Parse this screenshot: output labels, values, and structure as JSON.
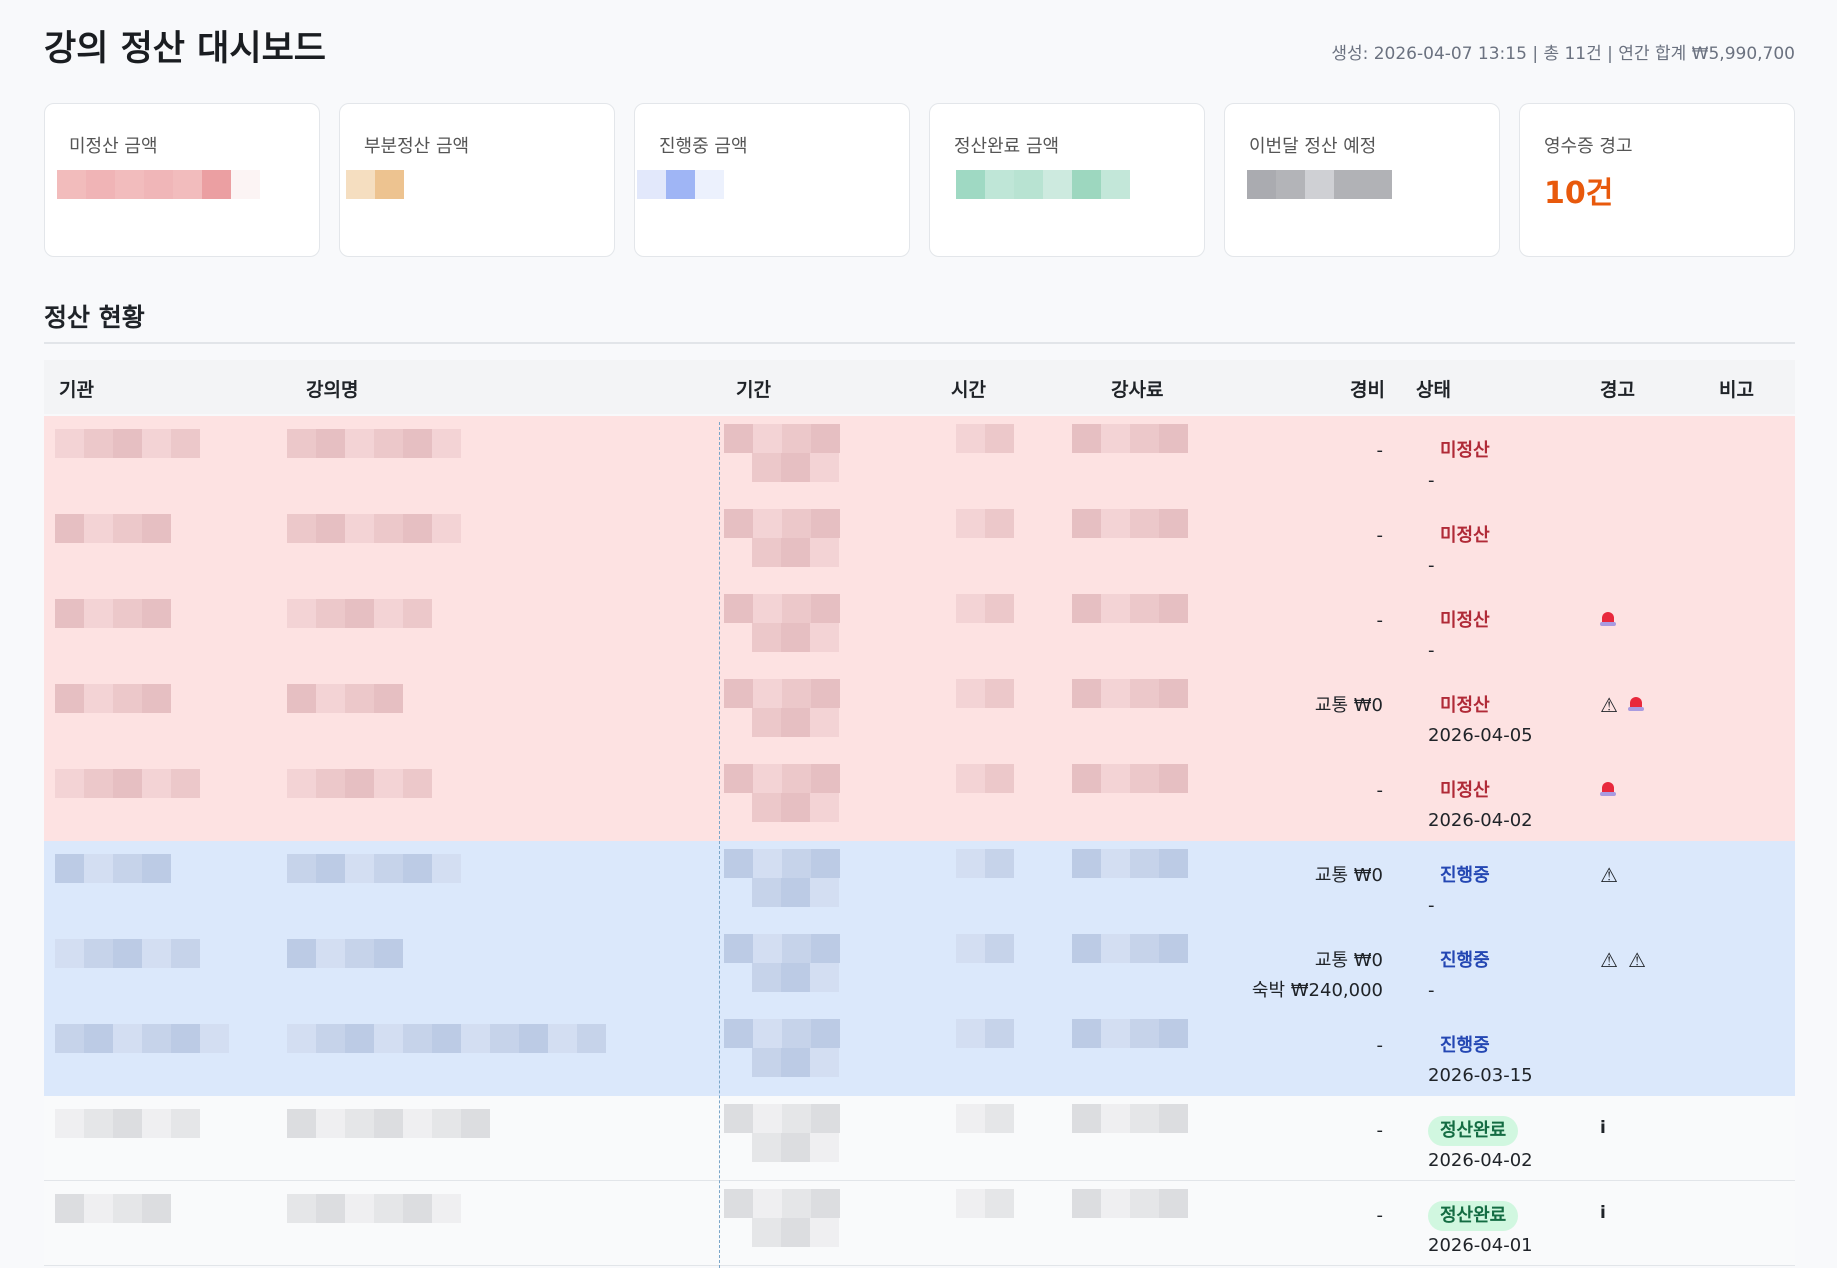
{
  "header": {
    "title": "강의 정산 대시보드",
    "meta": "생성: 2026-04-07 13:15 | 총 11건 | 연간 합계 ₩5,990,700"
  },
  "cards": [
    {
      "label": "미정산 금액"
    },
    {
      "label": "부분정산 금액"
    },
    {
      "label": "진행중 금액"
    },
    {
      "label": "정산완료 금액"
    },
    {
      "label": "이번달 정산 예정"
    },
    {
      "label": "영수증 경고",
      "value": "10건"
    }
  ],
  "section": {
    "title": "정산 현황"
  },
  "table": {
    "headers": [
      "기관",
      "강의명",
      "기간",
      "시간",
      "강사료",
      "경비",
      "상태",
      "경고",
      "비고"
    ],
    "rows": [
      {
        "type": "red",
        "expense": [
          "-"
        ],
        "status": "미정산",
        "date": "-",
        "warnings": []
      },
      {
        "type": "red",
        "expense": [
          "-"
        ],
        "status": "미정산",
        "date": "-",
        "warnings": []
      },
      {
        "type": "red",
        "expense": [
          "-"
        ],
        "status": "미정산",
        "date": "-",
        "warnings": [
          "siren"
        ]
      },
      {
        "type": "red",
        "expense": [
          "교통 ₩0"
        ],
        "status": "미정산",
        "date": "2026-04-05",
        "warnings": [
          "warning",
          "siren"
        ]
      },
      {
        "type": "red",
        "expense": [
          "-"
        ],
        "status": "미정산",
        "date": "2026-04-02",
        "warnings": [
          "siren"
        ]
      },
      {
        "type": "blue",
        "expense": [
          "교통 ₩0"
        ],
        "status": "진행중",
        "date": "-",
        "warnings": [
          "warning"
        ]
      },
      {
        "type": "blue",
        "expense": [
          "교통 ₩0",
          "숙박 ₩240,000"
        ],
        "status": "진행중",
        "date": "-",
        "warnings": [
          "warning",
          "warning"
        ]
      },
      {
        "type": "blue",
        "expense": [
          "-"
        ],
        "status": "진행중",
        "date": "2026-03-15",
        "warnings": []
      },
      {
        "type": "done",
        "expense": [
          "-"
        ],
        "status": "정산완료",
        "date": "2026-04-02",
        "warnings": [
          "info"
        ]
      },
      {
        "type": "done",
        "expense": [
          "-"
        ],
        "status": "정산완료",
        "date": "2026-04-01",
        "warnings": [
          "info"
        ]
      }
    ]
  },
  "colors": {
    "unpaid": "#b02a37",
    "progress": "#2447b3",
    "done": "#146c43",
    "alert": "#e8590c"
  }
}
